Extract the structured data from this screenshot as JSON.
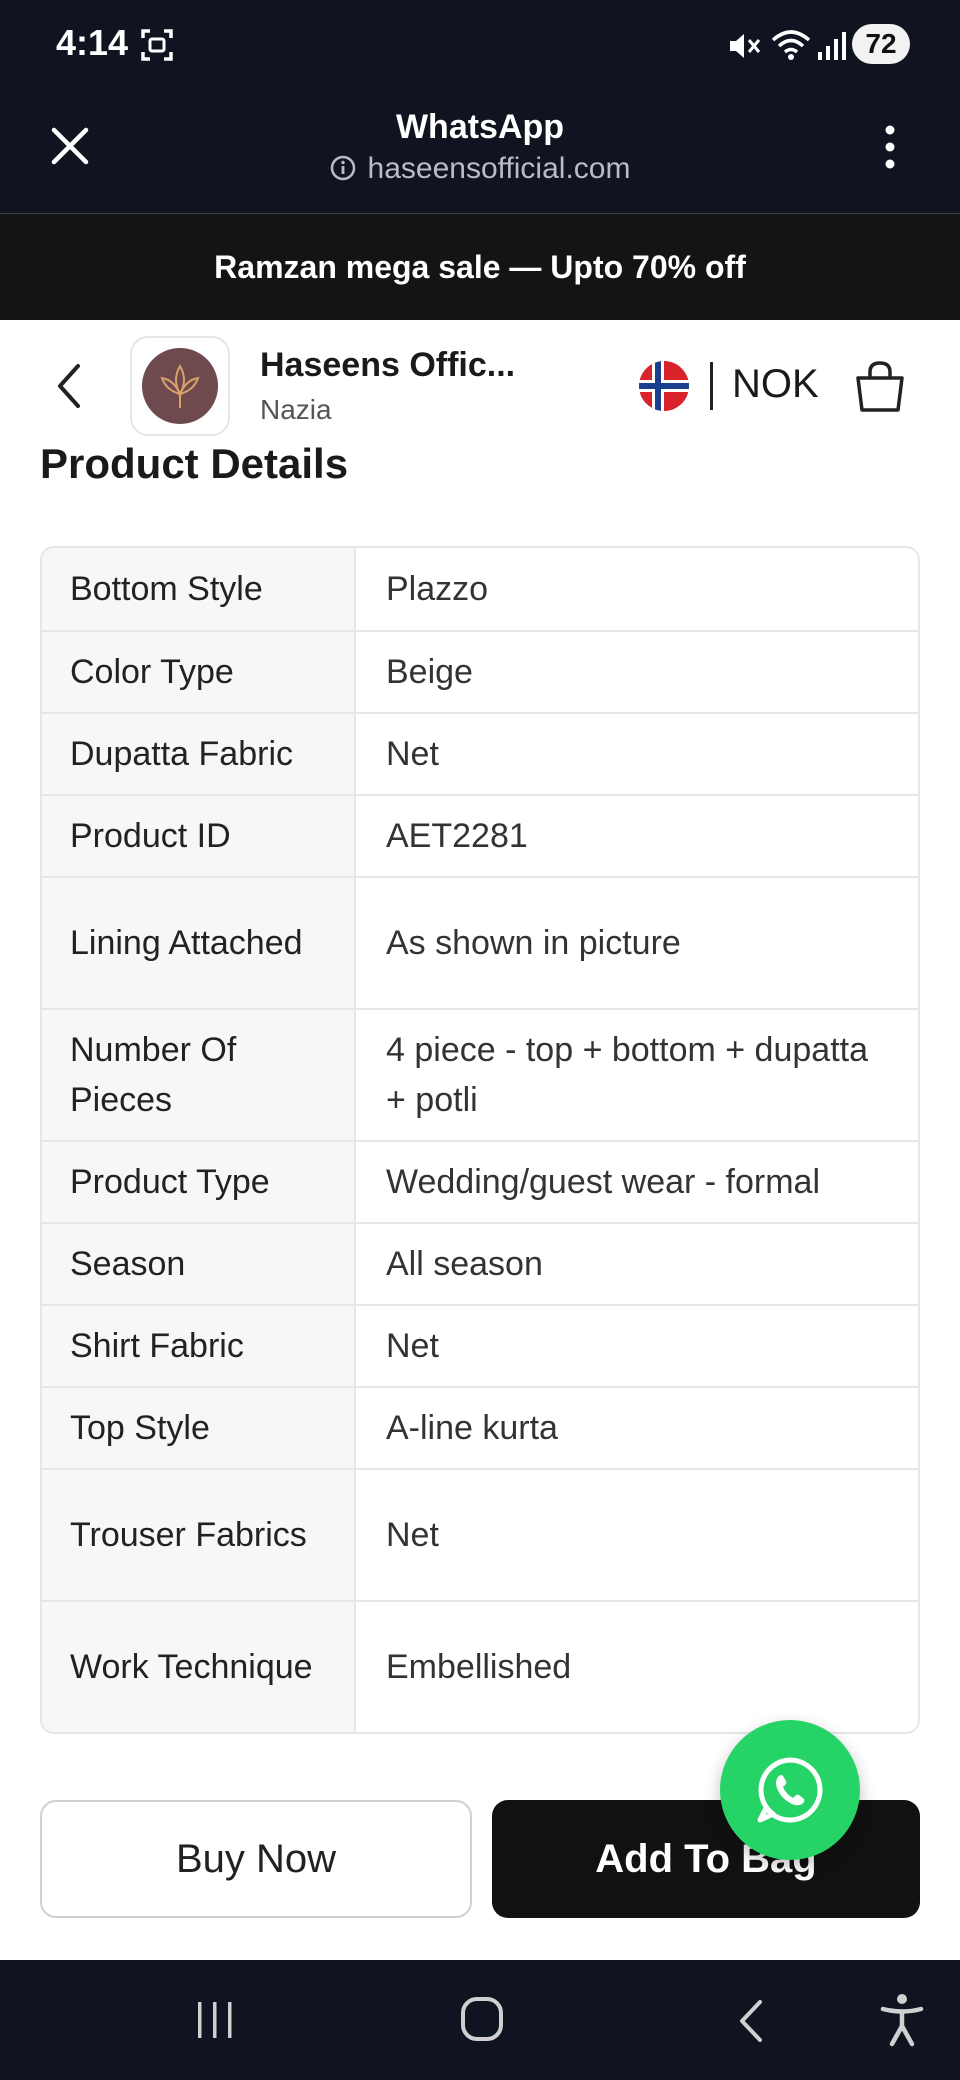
{
  "status_bar": {
    "time": "4:14",
    "battery": "72"
  },
  "browser": {
    "title": "WhatsApp",
    "url": "haseensofficial.com"
  },
  "promo": {
    "text": "Ramzan mega sale — Upto 70% off"
  },
  "store": {
    "name": "Haseens Offic...",
    "subtitle": "Nazia",
    "currency": "NOK"
  },
  "section_title": "Product Details",
  "details": [
    {
      "key": "Bottom Style",
      "value": "Plazzo"
    },
    {
      "key": "Color Type",
      "value": "Beige"
    },
    {
      "key": "Dupatta Fabric",
      "value": "Net"
    },
    {
      "key": "Product ID",
      "value": "AET2281"
    },
    {
      "key": "Lining Attached",
      "value": "As shown in picture"
    },
    {
      "key": "Number Of Pieces",
      "value": "4 piece - top + bottom + dupatta + potli"
    },
    {
      "key": "Product Type",
      "value": "Wedding/guest wear - formal"
    },
    {
      "key": "Season",
      "value": "All season"
    },
    {
      "key": "Shirt Fabric",
      "value": "Net"
    },
    {
      "key": "Top Style",
      "value": "A-line kurta"
    },
    {
      "key": "Trouser Fabrics",
      "value": "Net"
    },
    {
      "key": "Work Technique",
      "value": "Embellished"
    }
  ],
  "actions": {
    "buy_now": "Buy Now",
    "add_to_bag": "Add To Bag"
  },
  "colors": {
    "dark_bar": "#0f1420",
    "banner": "#141414",
    "whatsapp": "#25d366"
  }
}
